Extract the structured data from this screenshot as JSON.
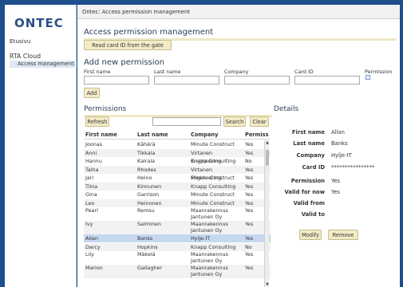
{
  "logo": "ONTEC",
  "nav": {
    "etusivu": "Etusivu",
    "rta_cloud": "RTA Cloud",
    "access_management": "Access management"
  },
  "window_title": "Ontec: Access permission management",
  "main": {
    "title": "Access permission management",
    "read_card_button": "Read card ID from the gate",
    "add_section_title": "Add new permission",
    "labels": {
      "first_name": "First name",
      "last_name": "Last name",
      "company": "Company",
      "card_id": "Card ID",
      "permission": "Permission"
    },
    "add_button": "Add"
  },
  "permissions": {
    "title": "Permissions",
    "refresh_button": "Refresh",
    "search_placeholder": "",
    "search_button": "Search",
    "clear_button": "Clear",
    "columns": [
      "First name",
      "Last name",
      "Company",
      "Permiss"
    ],
    "rows": [
      [
        "Joonas",
        "Kähärä",
        "Minute Construct",
        "Yes"
      ],
      [
        "Anni",
        "Tikkala",
        "Virtanen Engineering",
        "Yes"
      ],
      [
        "Hannu",
        "Kairala",
        "Knapp Consulting",
        "No"
      ],
      [
        "Talha",
        "Rhodes",
        "Virtanen Engineering",
        "Yes"
      ],
      [
        "Jari",
        "Heino",
        "Minute Construct",
        "Yes"
      ],
      [
        "Tiina",
        "Kinnunen",
        "Knapp Consulting",
        "Yes"
      ],
      [
        "Gina",
        "Garrison",
        "Minute Construct",
        "Yes"
      ],
      [
        "Leo",
        "Heinonen",
        "Minute Construct",
        "Yes"
      ],
      [
        "Pearl",
        "Remsu",
        "Maanrakennus Jantunen Oy",
        "Yes"
      ],
      [
        "Ivy",
        "Salminen",
        "Maanrakennus Jantunen Oy",
        "Yes"
      ],
      [
        "Allan",
        "Banks",
        "Hylje-IT",
        "Yes"
      ],
      [
        "Darcy",
        "Hopkins",
        "Knapp Consulting",
        "No"
      ],
      [
        "Lily",
        "Mäkelä",
        "Maanrakennus Jantunen Oy",
        "Yes"
      ],
      [
        "Marion",
        "Gallagher",
        "Maanrakennus Jantunen Oy",
        "Yes"
      ]
    ]
  },
  "details": {
    "title": "Details",
    "first_name_label": "First name",
    "first_name": "Allan",
    "last_name_label": "Last name",
    "last_name": "Banks",
    "company_label": "Company",
    "company": "Hylje-IT",
    "card_id_label": "Card ID",
    "card_id": "****************",
    "permission_label": "Permission",
    "permission": "Yes",
    "valid_for_now_label": "Valid for now",
    "valid_for_now": "Yes",
    "valid_from_label": "Valid from",
    "valid_to_label": "Valid to",
    "modify_button": "Modify",
    "remove_button": "Remove"
  }
}
